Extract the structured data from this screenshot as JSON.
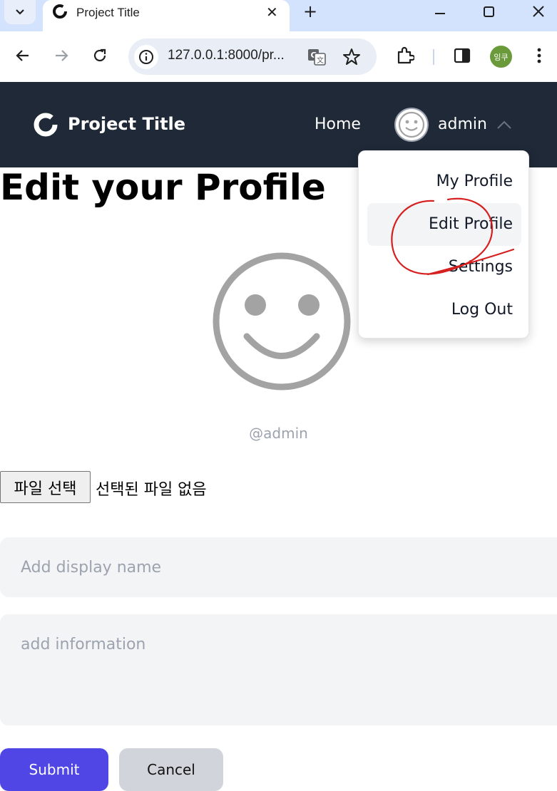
{
  "browser": {
    "tab_title": "Project Title",
    "url": "127.0.0.1:8000/pr...",
    "profile_initials": "잉쿠"
  },
  "navbar": {
    "brand": "Project Title",
    "home": "Home",
    "username": "admin"
  },
  "page": {
    "title": "Edit your Profile",
    "handle": "@admin",
    "file_button": "파일 선택",
    "file_status": "선택된 파일 없음",
    "display_placeholder": "Add display name",
    "info_placeholder": "add information",
    "submit_label": "Submit",
    "cancel_label": "Cancel"
  },
  "dropdown": {
    "items": [
      {
        "label": "My Profile"
      },
      {
        "label": "Edit Profile"
      },
      {
        "label": "Settings"
      },
      {
        "label": "Log Out"
      }
    ]
  },
  "colors": {
    "navbar_bg": "#1f2937",
    "accent": "#4f46e5",
    "annotation": "#d62020"
  }
}
